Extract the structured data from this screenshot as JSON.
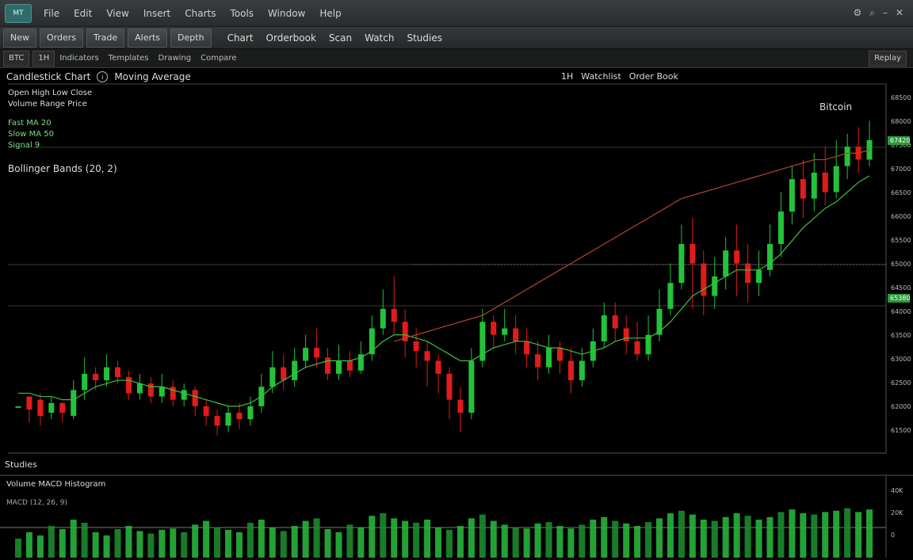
{
  "titlebar": {
    "logo": "MT",
    "menus": [
      "File",
      "Edit",
      "View",
      "Insert",
      "Charts",
      "Tools",
      "Window",
      "Help"
    ],
    "icons": [
      "settings-icon",
      "search-icon",
      "minimize-icon",
      "close-icon"
    ]
  },
  "toolbar": {
    "buttons": [
      "New",
      "Orders",
      "Trade",
      "Alerts",
      "Depth"
    ],
    "labels": [
      "Chart",
      "Orderbook",
      "Scan",
      "Watch",
      "Studies"
    ]
  },
  "toolbar2": {
    "symbol": "BTC",
    "timeframe": "1H",
    "items": [
      "Indicators",
      "Templates",
      "Drawing",
      "Compare"
    ],
    "right": "Replay"
  },
  "chart": {
    "header_left": "Candlestick Chart",
    "header_mid": "Moving Average",
    "header_right_1": "1H",
    "header_right_2": "Watchlist",
    "header_right_3": "Order Book",
    "info_lines": [
      "Open High Low Close",
      "Volume Range Price"
    ],
    "green_lines": [
      "Fast MA 20",
      "Slow MA 50",
      "Signal 9"
    ],
    "indicator_line": "Bollinger Bands (20, 2)",
    "corner_label": "Bitcoin",
    "price_labels": [
      "68500",
      "68000",
      "67500",
      "67000",
      "66500",
      "66000",
      "65500",
      "65000",
      "64500",
      "64000",
      "63500",
      "63000",
      "62500",
      "62000",
      "61500"
    ],
    "highlight_labels": [
      "67420",
      "65380"
    ],
    "colors": {
      "up": "#22c33a",
      "down": "#e21b1b",
      "ma_fast": "#3fbf3f",
      "ma_slow": "#b5452c",
      "grid": "#2a2a2a"
    }
  },
  "studies_label": "Studies",
  "volume": {
    "header": "Volume MACD Histogram",
    "sub": "MACD (12, 26, 9)",
    "price_labels": [
      "40K",
      "20K",
      "0"
    ]
  },
  "chart_data": {
    "type": "candlestick",
    "title": "",
    "candles": [
      [
        0,
        0,
        0,
        0
      ],
      [
        3,
        -1,
        -5,
        2
      ],
      [
        2,
        -3,
        -6,
        4
      ],
      [
        -2,
        1,
        -4,
        3
      ],
      [
        1,
        -2,
        -5,
        1
      ],
      [
        -3,
        5,
        -4,
        8
      ],
      [
        5,
        10,
        2,
        15
      ],
      [
        10,
        8,
        5,
        12
      ],
      [
        8,
        12,
        6,
        16
      ],
      [
        12,
        9,
        7,
        14
      ],
      [
        9,
        4,
        2,
        11
      ],
      [
        4,
        7,
        2,
        10
      ],
      [
        7,
        3,
        1,
        9
      ],
      [
        3,
        6,
        1,
        10
      ],
      [
        6,
        2,
        0,
        8
      ],
      [
        2,
        5,
        0,
        7
      ],
      [
        5,
        0,
        -3,
        6
      ],
      [
        0,
        -3,
        -6,
        2
      ],
      [
        -3,
        -6,
        -9,
        -1
      ],
      [
        -6,
        -2,
        -8,
        0
      ],
      [
        -2,
        -4,
        -7,
        1
      ],
      [
        -4,
        0,
        -6,
        3
      ],
      [
        0,
        6,
        -2,
        10
      ],
      [
        6,
        12,
        4,
        17
      ],
      [
        12,
        8,
        5,
        16
      ],
      [
        8,
        14,
        6,
        18
      ],
      [
        14,
        18,
        12,
        22
      ],
      [
        18,
        15,
        12,
        24
      ],
      [
        15,
        10,
        8,
        18
      ],
      [
        10,
        14,
        8,
        19
      ],
      [
        14,
        11,
        9,
        17
      ],
      [
        11,
        16,
        10,
        20
      ],
      [
        16,
        24,
        14,
        28
      ],
      [
        24,
        30,
        22,
        36
      ],
      [
        30,
        26,
        22,
        40
      ],
      [
        26,
        20,
        15,
        30
      ],
      [
        20,
        17,
        12,
        24
      ],
      [
        17,
        14,
        6,
        20
      ],
      [
        14,
        10,
        4,
        16
      ],
      [
        10,
        2,
        -4,
        12
      ],
      [
        2,
        -2,
        -8,
        6
      ],
      [
        -2,
        14,
        -4,
        18
      ],
      [
        14,
        26,
        12,
        30
      ],
      [
        26,
        22,
        18,
        28
      ],
      [
        22,
        24,
        20,
        30
      ],
      [
        24,
        20,
        16,
        28
      ],
      [
        20,
        16,
        12,
        24
      ],
      [
        16,
        12,
        8,
        20
      ],
      [
        12,
        18,
        10,
        22
      ],
      [
        18,
        14,
        10,
        20
      ],
      [
        14,
        8,
        4,
        18
      ],
      [
        8,
        14,
        6,
        18
      ],
      [
        14,
        20,
        12,
        24
      ],
      [
        20,
        28,
        18,
        32
      ],
      [
        28,
        24,
        20,
        32
      ],
      [
        24,
        20,
        16,
        28
      ],
      [
        20,
        16,
        14,
        26
      ],
      [
        16,
        22,
        14,
        28
      ],
      [
        22,
        30,
        20,
        36
      ],
      [
        30,
        38,
        28,
        44
      ],
      [
        38,
        50,
        36,
        56
      ],
      [
        50,
        44,
        30,
        58
      ],
      [
        44,
        34,
        28,
        48
      ],
      [
        34,
        40,
        30,
        46
      ],
      [
        40,
        48,
        36,
        52
      ],
      [
        48,
        44,
        34,
        56
      ],
      [
        44,
        38,
        32,
        50
      ],
      [
        38,
        42,
        34,
        48
      ],
      [
        42,
        50,
        40,
        56
      ],
      [
        50,
        60,
        46,
        66
      ],
      [
        60,
        70,
        56,
        74
      ],
      [
        70,
        64,
        58,
        76
      ],
      [
        64,
        72,
        60,
        78
      ],
      [
        72,
        66,
        62,
        80
      ],
      [
        66,
        74,
        64,
        82
      ],
      [
        74,
        80,
        70,
        84
      ],
      [
        80,
        76,
        72,
        86
      ],
      [
        76,
        82,
        74,
        88
      ]
    ],
    "ma_fast": [
      4,
      4,
      3,
      3,
      2,
      2,
      4,
      6,
      7,
      8,
      8,
      7,
      6,
      6,
      5,
      4,
      3,
      2,
      1,
      0,
      0,
      1,
      3,
      6,
      8,
      10,
      12,
      13,
      14,
      14,
      14,
      15,
      17,
      20,
      22,
      22,
      21,
      20,
      18,
      16,
      14,
      14,
      16,
      18,
      19,
      20,
      20,
      19,
      18,
      18,
      17,
      16,
      17,
      18,
      20,
      21,
      21,
      21,
      23,
      26,
      30,
      34,
      36,
      38,
      40,
      42,
      42,
      42,
      44,
      47,
      51,
      55,
      58,
      61,
      63,
      66,
      69,
      71
    ],
    "ma_slow": [
      null,
      null,
      null,
      null,
      null,
      null,
      null,
      null,
      null,
      null,
      null,
      null,
      null,
      null,
      null,
      null,
      null,
      null,
      null,
      null,
      null,
      null,
      null,
      null,
      null,
      null,
      null,
      null,
      null,
      null,
      null,
      null,
      null,
      null,
      20,
      21,
      22,
      23,
      24,
      25,
      26,
      27,
      28,
      30,
      32,
      34,
      36,
      38,
      40,
      42,
      44,
      46,
      48,
      50,
      52,
      54,
      56,
      58,
      60,
      62,
      64,
      65,
      66,
      67,
      68,
      69,
      70,
      71,
      72,
      73,
      74,
      75,
      76,
      76,
      77,
      78,
      78,
      79
    ],
    "volume": [
      30,
      40,
      35,
      50,
      45,
      60,
      55,
      40,
      35,
      45,
      50,
      42,
      38,
      44,
      46,
      40,
      52,
      58,
      48,
      44,
      40,
      55,
      60,
      48,
      42,
      50,
      58,
      62,
      45,
      40,
      52,
      48,
      66,
      70,
      62,
      58,
      55,
      60,
      48,
      44,
      50,
      62,
      68,
      58,
      52,
      48,
      46,
      54,
      56,
      50,
      46,
      52,
      60,
      64,
      58,
      54,
      50,
      56,
      62,
      70,
      74,
      68,
      60,
      58,
      64,
      70,
      66,
      60,
      64,
      72,
      76,
      70,
      68,
      72,
      74,
      78,
      72,
      76
    ]
  }
}
